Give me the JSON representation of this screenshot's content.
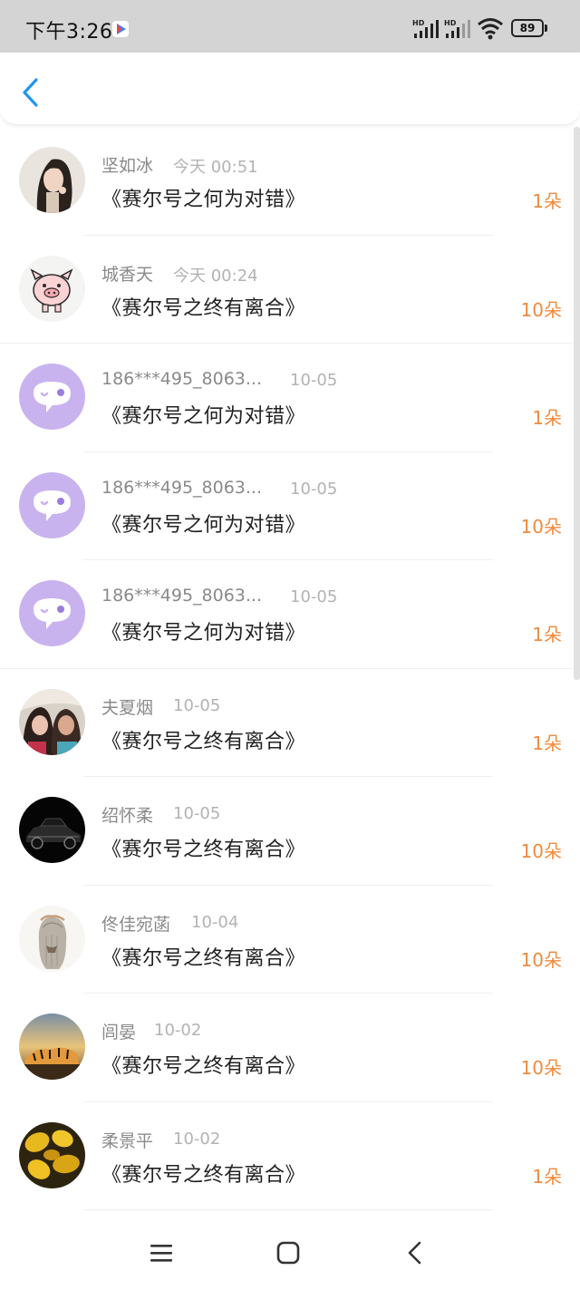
{
  "status_bar": {
    "time": "下午3:26",
    "battery": "89",
    "signal_label": "HD"
  },
  "colors": {
    "accent_blue": "#2196f3",
    "count_orange": "#f08a3c",
    "default_avatar": "#c9b3ef"
  },
  "header": {
    "back_icon": "chevron-left-icon"
  },
  "gifts": [
    {
      "user": "坚如冰",
      "time": "今天 00:51",
      "title": "《赛尔号之何为对错》",
      "count": "1朵",
      "avatar": "photo-woman"
    },
    {
      "user": "城香天",
      "time": "今天 00:24",
      "title": "《赛尔号之终有离合》",
      "count": "10朵",
      "avatar": "cartoon-pig"
    },
    {
      "user": "186***495_8063...",
      "time": "10-05",
      "title": "《赛尔号之何为对错》",
      "count": "1朵",
      "avatar": "default-chat"
    },
    {
      "user": "186***495_8063...",
      "time": "10-05",
      "title": "《赛尔号之何为对错》",
      "count": "10朵",
      "avatar": "default-chat"
    },
    {
      "user": "186***495_8063...",
      "time": "10-05",
      "title": "《赛尔号之何为对错》",
      "count": "1朵",
      "avatar": "default-chat"
    },
    {
      "user": "夫夏烟",
      "time": "10-05",
      "title": "《赛尔号之终有离合》",
      "count": "1朵",
      "avatar": "photo-two-women"
    },
    {
      "user": "绍怀柔",
      "time": "10-05",
      "title": "《赛尔号之终有离合》",
      "count": "10朵",
      "avatar": "photo-black-car"
    },
    {
      "user": "佟佳宛菡",
      "time": "10-04",
      "title": "《赛尔号之终有离合》",
      "count": "10朵",
      "avatar": "drawing-girl-back"
    },
    {
      "user": "闾晏",
      "time": "10-02",
      "title": "《赛尔号之终有离合》",
      "count": "10朵",
      "avatar": "photo-tiger"
    },
    {
      "user": "柔景平",
      "time": "10-02",
      "title": "《赛尔号之终有离合》",
      "count": "1朵",
      "avatar": "photo-yellow-leaves"
    }
  ],
  "nav_bar": {
    "menu_icon": "menu-icon",
    "home_icon": "home-square-icon",
    "back_icon": "back-triangle-icon"
  }
}
